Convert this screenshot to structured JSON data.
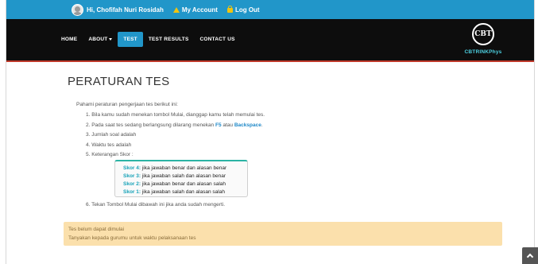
{
  "topbar": {
    "greeting": "Hi, Chofifah Nuri Rosidah",
    "my_account": "My Account",
    "logout": "Log Out"
  },
  "nav": {
    "items": [
      {
        "label": "HOME"
      },
      {
        "label": "ABOUT"
      },
      {
        "label": "TEST",
        "active": true
      },
      {
        "label": "TEST RESULTS"
      },
      {
        "label": "CONTACT US"
      }
    ]
  },
  "logo": {
    "mark": "CBT",
    "text": "CBTRINKPhys"
  },
  "page": {
    "title": "PERATURAN TES",
    "intro": "Pahami peraturan pengerjaan tes berikut ini:",
    "rules": {
      "r1": "1. Bila kamu sudah menekan tombol Mulai, dianggap kamu telah memulai tes.",
      "r2_prefix": "2. Pada saat tes sedang berlangsung dilarang menekan ",
      "r2_key1": "F5",
      "r2_mid": " atau ",
      "r2_key2": "Backspace",
      "r2_suffix": ".",
      "r3": "3. Jumlah soal adalah",
      "r4": "4. Waktu tes adalah",
      "r5": "5. Keterangan Skor :",
      "r6": "6. Tekan Tombol Mulai dibawah ini jika anda sudah mengerti."
    },
    "skor": [
      {
        "label": "Skor 4:",
        "desc": "jika jawaban benar dan alasan benar"
      },
      {
        "label": "Skor 3:",
        "desc": "jika jawaban salah dan alasan benar"
      },
      {
        "label": "Skor 2:",
        "desc": "jika jawaban benar dan alasan salah"
      },
      {
        "label": "Skor 1:",
        "desc": "jika jawaban salah dan alasan salah"
      }
    ],
    "alert": {
      "line1": "Tes belum dapat dimulai",
      "line2": "Tanyakan kepada gurumu untuk waktu pelaksanaan tes"
    }
  },
  "colors": {
    "topbar": "#2196c9",
    "navbar": "#0d0d0d",
    "accent": "#2196c9",
    "alert_bg": "#fbe0ac",
    "skor_label": "#17a2b8"
  }
}
